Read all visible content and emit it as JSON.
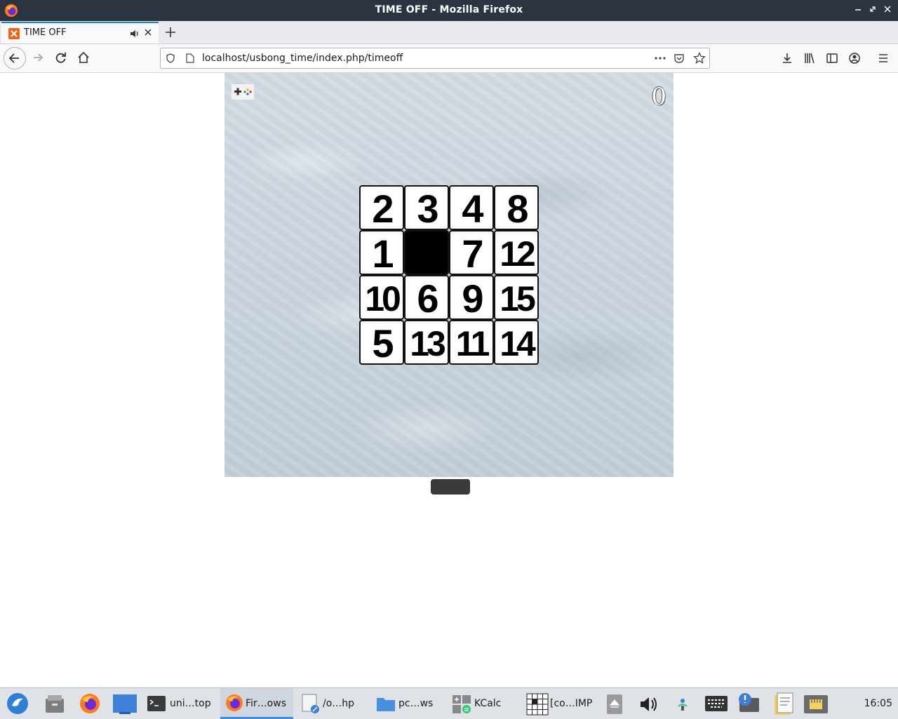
{
  "window": {
    "title": "TIME OFF - Mozilla Firefox"
  },
  "tabs": [
    {
      "label": "TIME OFF"
    }
  ],
  "nav": {
    "url": "localhost/usbong_time/index.php/timeoff"
  },
  "game": {
    "score": "0",
    "tiles": [
      [
        "2",
        "3",
        "4",
        "8"
      ],
      [
        "1",
        "",
        "7",
        "12"
      ],
      [
        "10",
        "6",
        "9",
        "15"
      ],
      [
        "5",
        "13",
        "11",
        "14"
      ]
    ]
  },
  "taskbar": {
    "items": [
      {
        "label": "uni…top"
      },
      {
        "label": "Fir…ows"
      },
      {
        "label": "/o…hp"
      },
      {
        "label": "pc…ws"
      },
      {
        "label": "KCalc"
      },
      {
        "label": "[co…IMP"
      }
    ],
    "clock": "16:05"
  },
  "colors": {
    "accent": "#0a84ff",
    "titlebar": "#2b3440",
    "taskbar_active": "#3d8ee0"
  }
}
